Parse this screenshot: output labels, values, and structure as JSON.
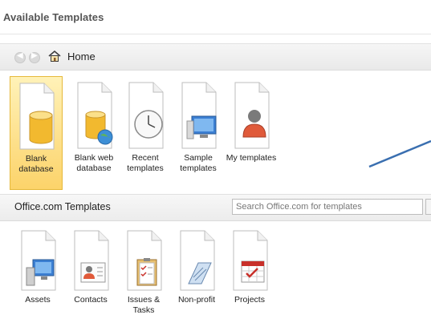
{
  "page": {
    "title": "Available Templates"
  },
  "nav": {
    "back_label": "back",
    "forward_label": "forward",
    "home_label": "Home"
  },
  "available": [
    {
      "label1": "Blank",
      "label2": "database",
      "selected": true
    },
    {
      "label1": "Blank web",
      "label2": "database"
    },
    {
      "label1": "Recent",
      "label2": "templates"
    },
    {
      "label1": "Sample",
      "label2": "templates"
    },
    {
      "label1": "My templates",
      "label2": ""
    }
  ],
  "office": {
    "section_label": "Office.com Templates",
    "search_placeholder": "Search Office.com for templates",
    "items": [
      {
        "label1": "Assets",
        "label2": ""
      },
      {
        "label1": "Contacts",
        "label2": ""
      },
      {
        "label1": "Issues &",
        "label2": "Tasks"
      },
      {
        "label1": "Non-profit",
        "label2": ""
      },
      {
        "label1": "Projects",
        "label2": ""
      }
    ]
  },
  "colors": {
    "selected_bg": "#fcd36a",
    "arrow": "#3a6fb0"
  },
  "icons": [
    "home-icon",
    "database-icon",
    "web-database-icon",
    "clock-icon",
    "monitor-icon",
    "person-icon",
    "assets-icon",
    "contacts-icon",
    "issues-icon",
    "nonprofit-icon",
    "projects-icon"
  ]
}
